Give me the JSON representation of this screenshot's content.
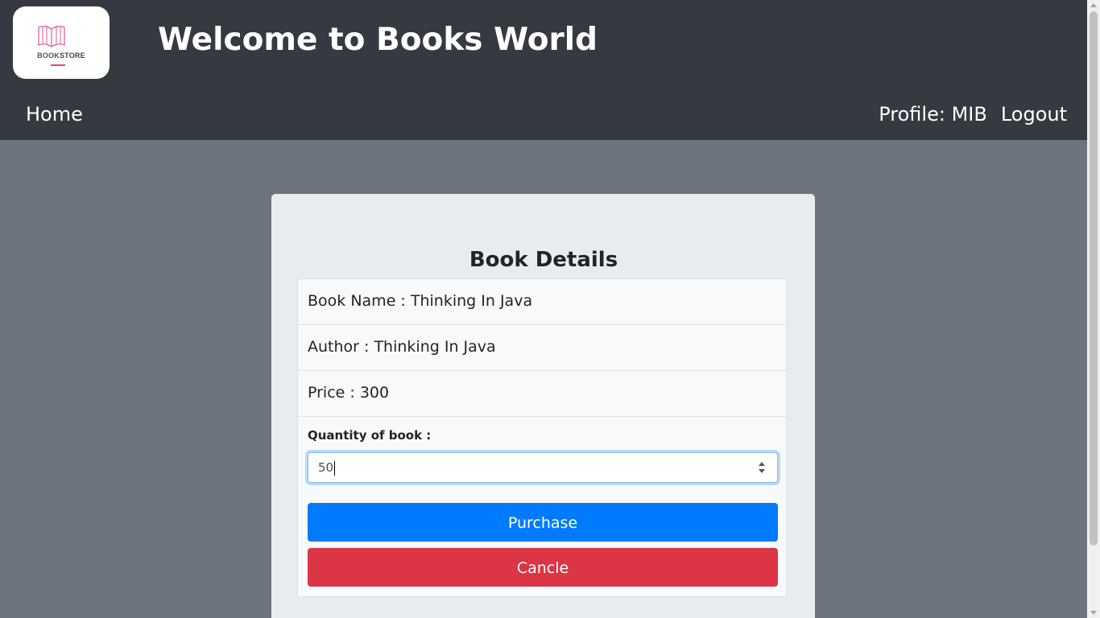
{
  "header": {
    "logo_text_book": "BOOK",
    "logo_text_store": "STORE",
    "title": "Welcome to Books World"
  },
  "nav": {
    "home": "Home",
    "profile": "Profile: MIB",
    "logout": "Logout"
  },
  "book_details": {
    "title": "Book Details",
    "rows": [
      {
        "label": "Book Name : ",
        "value": "Thinking In Java"
      },
      {
        "label": "Author : ",
        "value": "Thinking In Java"
      },
      {
        "label": "Price : ",
        "value": "300"
      }
    ],
    "quantity_label": "Quantity of book :",
    "quantity_value": "50",
    "purchase_label": "Purchase",
    "cancel_label": "Cancle"
  },
  "colors": {
    "navbar": "#343a40",
    "page_bg": "#6c757d",
    "card_bg": "#e9ecef",
    "purchase": "#007bff",
    "cancel": "#dc3545",
    "logo_accent": "#e0457b"
  }
}
